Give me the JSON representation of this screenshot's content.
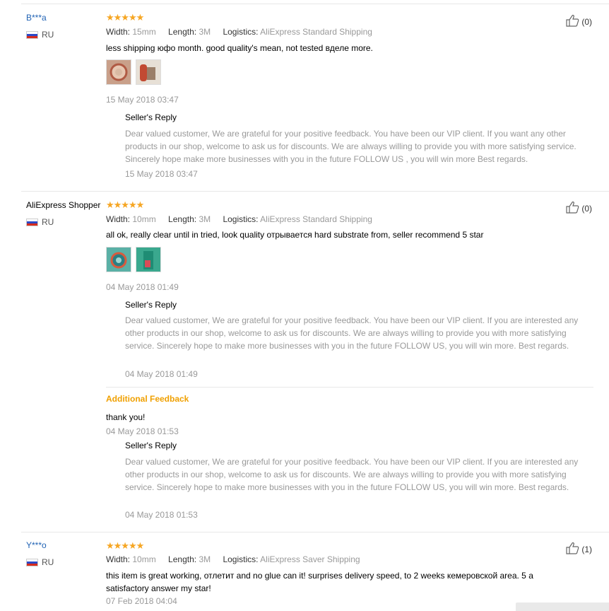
{
  "reviews": [
    {
      "user": "B***a",
      "country": "RU",
      "width_label": "Width:",
      "width_value": "15mm",
      "length_label": "Length:",
      "length_value": "3M",
      "logistics_label": "Logistics:",
      "logistics_value": "AliExpress Standard Shipping",
      "text": "less shipping юфо month. good quality's mean, not tested вделе more.",
      "date": "15 May 2018 03:47",
      "helpful": "(0)",
      "stars": 5,
      "reply_title": "Seller's Reply",
      "reply_text": "Dear valued customer, We are grateful for your positive feedback. You have been our VIP client. If you want any other products in our shop, welcome to ask us for discounts. We are always willing to provide you with more satisfying service. Sincerely hope make more businesses with you in the future FOLLOW US , you will win more Best regards.",
      "reply_date": "15 May 2018 03:47"
    },
    {
      "user": "AliExpress Shopper",
      "country": "RU",
      "width_label": "Width:",
      "width_value": "10mm",
      "length_label": "Length:",
      "length_value": "3M",
      "logistics_label": "Logistics:",
      "logistics_value": "AliExpress Standard Shipping",
      "text": "all ok, really clear until in tried, look quality отрывается hard substrate from, seller recommend 5 star",
      "date": "04 May 2018 01:49",
      "helpful": "(0)",
      "stars": 5,
      "reply_title": "Seller's Reply",
      "reply_text": "Dear valued customer, We are grateful for your positive feedback. You have been our VIP client. If you are interested any other products in our shop, welcome to ask us for discounts. We are always willing to provide you with more satisfying service. Sincerely hope to make more businesses with you in the future FOLLOW US, you will win more. Best regards.",
      "reply_date": "04 May 2018 01:49",
      "additional": {
        "title": "Additional Feedback",
        "text": "thank you!",
        "date": "04 May 2018 01:53",
        "reply_title": "Seller's Reply",
        "reply_text": "Dear valued customer, We are grateful for your positive feedback. You have been our VIP client. If you are interested any other products in our shop, welcome to ask us for discounts. We are always willing to provide you with more satisfying service. Sincerely hope to make more businesses with you in the future FOLLOW US, you will win more. Best regards.",
        "reply_date": "04 May 2018 01:53"
      }
    },
    {
      "user": "Y***o",
      "country": "RU",
      "width_label": "Width:",
      "width_value": "10mm",
      "length_label": "Length:",
      "length_value": "3M",
      "logistics_label": "Logistics:",
      "logistics_value": "AliExpress Saver Shipping",
      "text": "this item is great working, отлетит and no glue can it! surprises delivery speed, to 2 weeks кемеровской area. 5 a satisfactory answer my star!",
      "date": "07 Feb 2018 04:04",
      "helpful": "(1)",
      "stars": 5
    }
  ],
  "stars_glyph": "★★★★★",
  "colors": {
    "link": "#2264b5",
    "star": "#f6a623",
    "additional": "#f0a000"
  }
}
